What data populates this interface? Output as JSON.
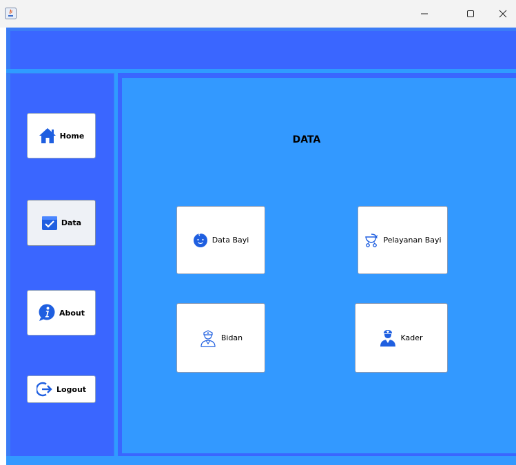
{
  "window": {
    "controls": {
      "minimize_icon": "minimize-icon",
      "maximize_icon": "maximize-icon",
      "close_icon": "close-icon"
    }
  },
  "sidebar": {
    "items": [
      {
        "label": "Home",
        "icon": "home-icon"
      },
      {
        "label": "Data",
        "icon": "data-box-icon",
        "selected": true
      },
      {
        "label": "About",
        "icon": "info-icon"
      },
      {
        "label": "Logout",
        "icon": "logout-icon"
      }
    ]
  },
  "main": {
    "title": "DATA",
    "cards": [
      {
        "label": "Data Bayi",
        "icon": "baby-face-icon"
      },
      {
        "label": "Pelayanan Bayi",
        "icon": "baby-stroller-icon"
      },
      {
        "label": "Bidan",
        "icon": "nurse-icon"
      },
      {
        "label": "Kader",
        "icon": "doctor-icon"
      }
    ]
  },
  "colors": {
    "header": "#3a66ff",
    "sidebar": "#3a66ff",
    "content": "#3399ff",
    "accent_icon": "#1f5fe0"
  }
}
